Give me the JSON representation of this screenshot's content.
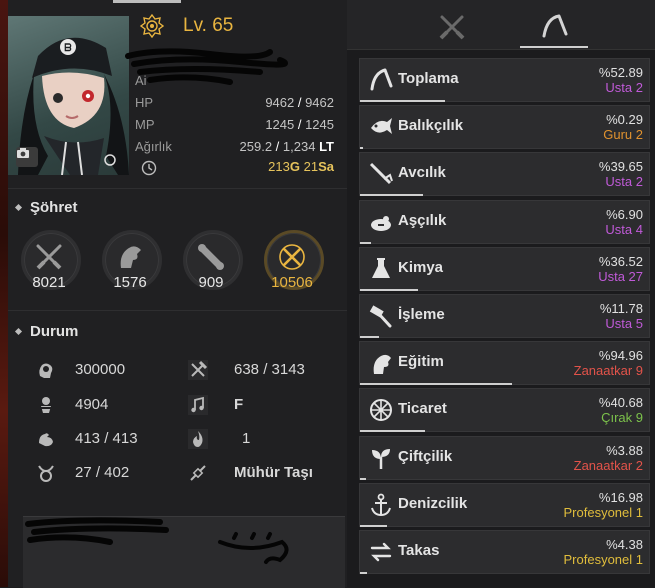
{
  "character": {
    "level_prefix": "Lv.",
    "level": "65",
    "hp_label": "HP",
    "hp_current": "9462",
    "hp_max": "9462",
    "mp_label": "MP",
    "mp_current": "1245",
    "mp_max": "1245",
    "weight_label": "Ağırlık",
    "weight_current": "259.2",
    "weight_max": "1,234",
    "weight_unit": "LT",
    "time_hours": "213",
    "time_hours_unit": "G",
    "time_minutes": "21",
    "time_minutes_unit": "Sa",
    "partial_label": "Ai"
  },
  "fame": {
    "title": "Şöhret",
    "items": [
      {
        "icon": "crossed-swords-icon",
        "value": "8021"
      },
      {
        "icon": "horse-head-icon",
        "value": "1576"
      },
      {
        "icon": "scroll-icon",
        "value": "909"
      },
      {
        "icon": "gold-crossed-swords-icon",
        "value": "10506"
      }
    ]
  },
  "status": {
    "title": "Durum",
    "left": [
      {
        "icon": "brain-icon",
        "value": "300000"
      },
      {
        "icon": "medal-icon",
        "value": "4904"
      },
      {
        "icon": "muscle-icon",
        "value": "413 / 413"
      },
      {
        "icon": "taurus-icon",
        "value": "27 / 402"
      }
    ],
    "right": [
      {
        "icon": "pickaxe-icon",
        "value": "638 / 3143"
      },
      {
        "icon": "music-note-icon",
        "value": "F"
      },
      {
        "icon": "flame-icon",
        "value": "1"
      },
      {
        "icon": "chain-icon",
        "value": "Mühür Taşı"
      }
    ]
  },
  "tabs": [
    {
      "icon": "crossed-swords-icon",
      "active": false
    },
    {
      "icon": "sickle-icon",
      "active": true
    }
  ],
  "lifeskills": [
    {
      "name": "Toplama",
      "pct": "%52.89",
      "rank": "Usta 2",
      "rank_color": "#c05ad8",
      "progress": 0.5289,
      "icon": "sickle-icon"
    },
    {
      "name": "Balıkçılık",
      "pct": "%0.29",
      "rank": "Guru 2",
      "rank_color": "#e0922f",
      "progress": 0.0029,
      "icon": "fish-icon"
    },
    {
      "name": "Avcılık",
      "pct": "%39.65",
      "rank": "Usta 2",
      "rank_color": "#c05ad8",
      "progress": 0.3965,
      "icon": "rifle-icon"
    },
    {
      "name": "Aşçılık",
      "pct": "%6.90",
      "rank": "Usta 4",
      "rank_color": "#c05ad8",
      "progress": 0.069,
      "icon": "cooking-pot-icon"
    },
    {
      "name": "Kimya",
      "pct": "%36.52",
      "rank": "Usta 27",
      "rank_color": "#c05ad8",
      "progress": 0.3652,
      "icon": "flask-icon"
    },
    {
      "name": "İşleme",
      "pct": "%11.78",
      "rank": "Usta 5",
      "rank_color": "#c05ad8",
      "progress": 0.1178,
      "icon": "hammer-icon"
    },
    {
      "name": "Eğitim",
      "pct": "%94.96",
      "rank": "Zanaatkar 9",
      "rank_color": "#e2534a",
      "progress": 0.9496,
      "icon": "horse-head-icon"
    },
    {
      "name": "Ticaret",
      "pct": "%40.68",
      "rank": "Çırak 9",
      "rank_color": "#7cc24b",
      "progress": 0.4068,
      "icon": "wheel-icon"
    },
    {
      "name": "Çiftçilik",
      "pct": "%3.88",
      "rank": "Zanaatkar 2",
      "rank_color": "#e2534a",
      "progress": 0.0388,
      "icon": "sprout-icon"
    },
    {
      "name": "Denizcilik",
      "pct": "%16.98",
      "rank": "Profesyonel 1",
      "rank_color": "#e0bd3c",
      "progress": 0.1698,
      "icon": "anchor-icon"
    },
    {
      "name": "Takas",
      "pct": "%4.38",
      "rank": "Profesyonel 1",
      "rank_color": "#e0bd3c",
      "progress": 0.0438,
      "icon": "swap-arrows-icon"
    }
  ]
}
